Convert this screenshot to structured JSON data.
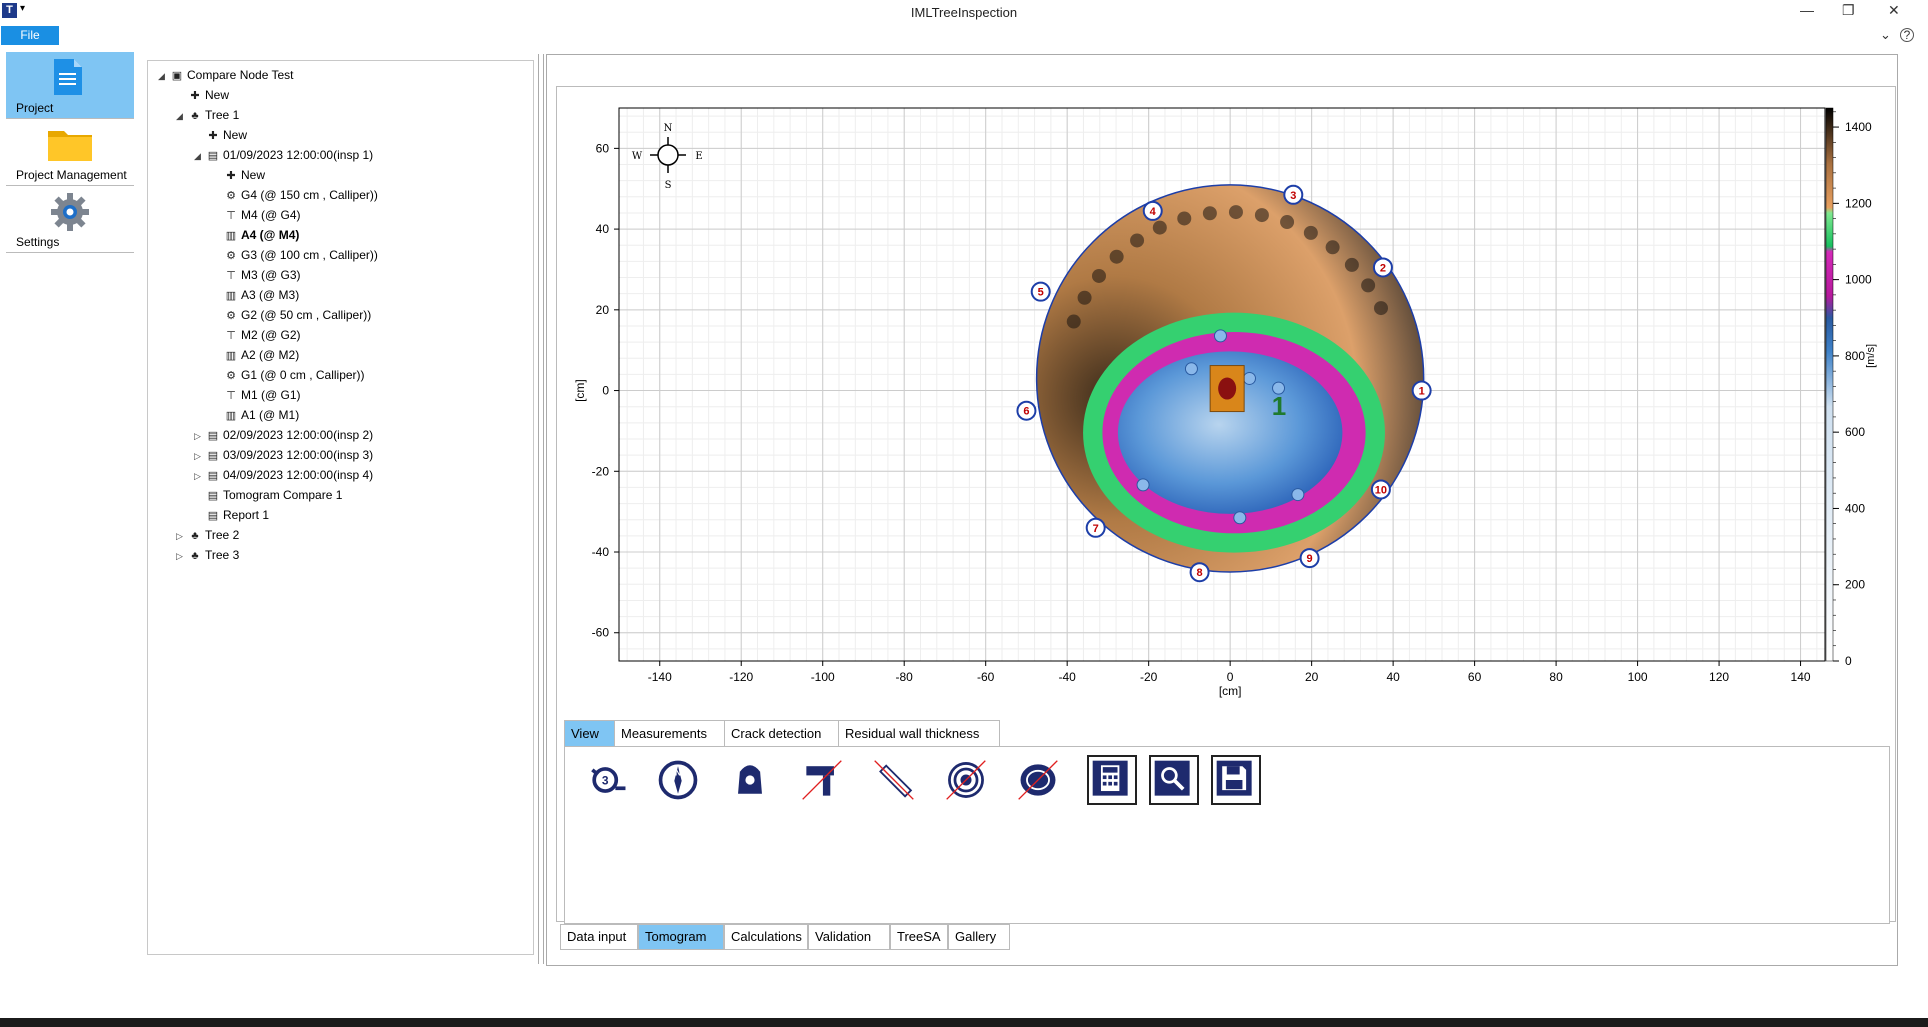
{
  "window": {
    "title": "IMLTreeInspection",
    "app_icon_letter": "T"
  },
  "menu": {
    "file": "File"
  },
  "nav": [
    {
      "label": "Project",
      "icon": "document-icon",
      "active": true
    },
    {
      "label": "Project Management",
      "icon": "folder-icon",
      "active": false
    },
    {
      "label": "Settings",
      "icon": "gear-icon",
      "active": false
    }
  ],
  "tree": [
    {
      "label": "Compare Node Test",
      "level": 0,
      "exp": "◢",
      "icon": "project-icon",
      "bold": false
    },
    {
      "label": "New",
      "level": 1,
      "exp": "",
      "icon": "plus-icon",
      "bold": false
    },
    {
      "label": "Tree 1",
      "level": 1,
      "exp": "◢",
      "icon": "tree-icon",
      "bold": false
    },
    {
      "label": "New",
      "level": 2,
      "exp": "",
      "icon": "plus-icon",
      "bold": false
    },
    {
      "label": "01/09/2023 12:00:00(insp 1)",
      "level": 2,
      "exp": "◢",
      "icon": "inspection-icon",
      "bold": false
    },
    {
      "label": "New",
      "level": 3,
      "exp": "",
      "icon": "plus-icon",
      "bold": false
    },
    {
      "label": "G4 (@ 150 cm , Calliper))",
      "level": 3,
      "exp": "",
      "icon": "geometry-icon",
      "bold": false
    },
    {
      "label": "M4 (@ G4)",
      "level": 3,
      "exp": "",
      "icon": "measurement-icon",
      "bold": false
    },
    {
      "label": "A4 (@ M4)",
      "level": 3,
      "exp": "",
      "icon": "analysis-icon",
      "bold": true
    },
    {
      "label": "G3 (@ 100 cm , Calliper))",
      "level": 3,
      "exp": "",
      "icon": "geometry-icon",
      "bold": false
    },
    {
      "label": "M3 (@ G3)",
      "level": 3,
      "exp": "",
      "icon": "measurement-icon",
      "bold": false
    },
    {
      "label": "A3 (@ M3)",
      "level": 3,
      "exp": "",
      "icon": "analysis-icon",
      "bold": false
    },
    {
      "label": "G2 (@ 50 cm , Calliper))",
      "level": 3,
      "exp": "",
      "icon": "geometry-icon",
      "bold": false
    },
    {
      "label": "M2 (@ G2)",
      "level": 3,
      "exp": "",
      "icon": "measurement-icon",
      "bold": false
    },
    {
      "label": "A2 (@ M2)",
      "level": 3,
      "exp": "",
      "icon": "analysis-icon",
      "bold": false
    },
    {
      "label": "G1 (@ 0 cm , Calliper))",
      "level": 3,
      "exp": "",
      "icon": "geometry-icon",
      "bold": false
    },
    {
      "label": "M1 (@ G1)",
      "level": 3,
      "exp": "",
      "icon": "measurement-icon",
      "bold": false
    },
    {
      "label": "A1 (@ M1)",
      "level": 3,
      "exp": "",
      "icon": "analysis-icon",
      "bold": false
    },
    {
      "label": "02/09/2023 12:00:00(insp 2)",
      "level": 2,
      "exp": "▷",
      "icon": "inspection-icon",
      "bold": false
    },
    {
      "label": "03/09/2023 12:00:00(insp 3)",
      "level": 2,
      "exp": "▷",
      "icon": "inspection-icon",
      "bold": false
    },
    {
      "label": "04/09/2023 12:00:00(insp 4)",
      "level": 2,
      "exp": "▷",
      "icon": "inspection-icon",
      "bold": false
    },
    {
      "label": "Tomogram Compare 1",
      "level": 2,
      "exp": "",
      "icon": "inspection-icon",
      "bold": false
    },
    {
      "label": "Report 1",
      "level": 2,
      "exp": "",
      "icon": "inspection-icon",
      "bold": false
    },
    {
      "label": "Tree 2",
      "level": 1,
      "exp": "▷",
      "icon": "tree-icon",
      "bold": false
    },
    {
      "label": "Tree 3",
      "level": 1,
      "exp": "▷",
      "icon": "tree-icon",
      "bold": false
    }
  ],
  "chart_data": {
    "type": "heatmap",
    "xlabel": "[cm]",
    "ylabel": "[cm]",
    "xlim": [
      -150,
      146
    ],
    "ylim": [
      -67,
      70
    ],
    "xticks": [
      -140,
      -120,
      -100,
      -80,
      -60,
      -40,
      -20,
      0,
      20,
      40,
      60,
      80,
      100,
      120,
      140
    ],
    "yticks": [
      60,
      40,
      20,
      0,
      -20,
      -40,
      -60
    ],
    "grid": true,
    "colorbar": {
      "label": "[m/s]",
      "range": [
        0,
        1450
      ],
      "ticks": [
        0,
        200,
        400,
        600,
        800,
        1000,
        1200,
        1400
      ]
    },
    "compass": {
      "n": "N",
      "s": "S",
      "e": "E",
      "w": "W"
    },
    "cross_section": {
      "center": [
        0,
        3
      ],
      "radius": 47.5
    },
    "sensors": [
      {
        "label": "1",
        "x": 47,
        "y": 0
      },
      {
        "label": "2",
        "x": 37.5,
        "y": 30.5
      },
      {
        "label": "3",
        "x": 15.5,
        "y": 48.5
      },
      {
        "label": "4",
        "x": -19,
        "y": 44.5
      },
      {
        "label": "5",
        "x": -46.5,
        "y": 24.5
      },
      {
        "label": "6",
        "x": -50,
        "y": -5
      },
      {
        "label": "7",
        "x": -33,
        "y": -34
      },
      {
        "label": "8",
        "x": -7.5,
        "y": -45
      },
      {
        "label": "9",
        "x": 19.5,
        "y": -41.5
      },
      {
        "label": "10",
        "x": 37,
        "y": -24.5
      }
    ],
    "region_label": {
      "text": "1",
      "x": 12,
      "y": -6
    }
  },
  "inner_tabs": [
    "View",
    "Measurements",
    "Crack detection",
    "Residual wall thickness"
  ],
  "inner_tab_active": 0,
  "tools": [
    {
      "icon": "sensor-number-icon",
      "glyph": "3",
      "framed": false,
      "disabled": false
    },
    {
      "icon": "compass-icon",
      "glyph": "N",
      "framed": false,
      "disabled": false
    },
    {
      "icon": "tree-marker-icon",
      "glyph": "",
      "framed": false,
      "disabled": false
    },
    {
      "icon": "hammer-icon",
      "glyph": "",
      "framed": false,
      "disabled": true
    },
    {
      "icon": "ruler-icon",
      "glyph": "",
      "framed": false,
      "disabled": true
    },
    {
      "icon": "rings-icon",
      "glyph": "",
      "framed": false,
      "disabled": true
    },
    {
      "icon": "wood-disc-icon",
      "glyph": "",
      "framed": false,
      "disabled": true
    },
    {
      "icon": "calculator-icon",
      "glyph": "",
      "framed": true,
      "disabled": false
    },
    {
      "icon": "zoom-icon",
      "glyph": "",
      "framed": true,
      "disabled": false
    },
    {
      "icon": "save-icon",
      "glyph": "",
      "framed": true,
      "disabled": false
    }
  ],
  "bottom_tabs": [
    "Data input",
    "Tomogram",
    "Calculations",
    "Validation",
    "TreeSA",
    "Gallery"
  ],
  "bottom_tab_active": 1,
  "colors": {
    "accent": "#7fc5f3",
    "file_menu": "#1a8fe3",
    "sensor_ring": "#1d3ea8",
    "sensor_text": "#c00000",
    "region_label": "#1f7a2e"
  }
}
